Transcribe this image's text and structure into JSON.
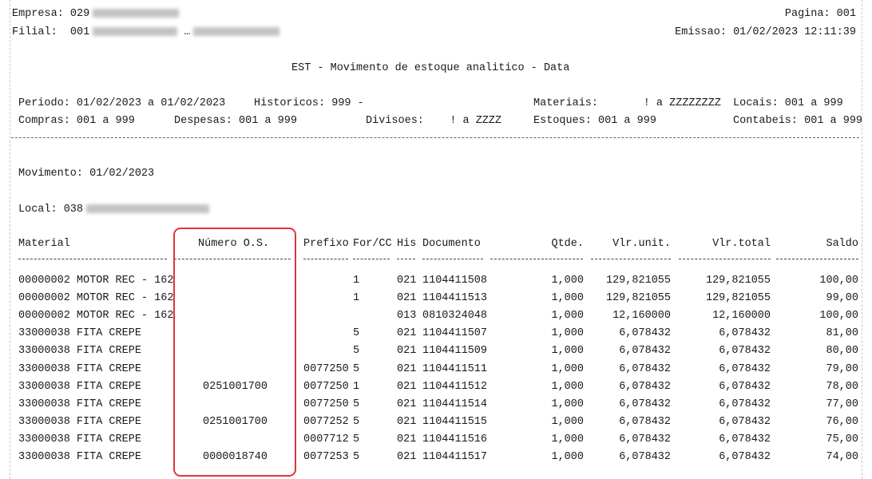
{
  "header": {
    "empresa_label": "Empresa: 029",
    "filial_label": "Filial:",
    "filial_code": "001",
    "filial_sep": "…",
    "pagina": "Pagina: 001",
    "emissao": "Emissao: 01/02/2023 12:11:39",
    "title": "EST - Movimento de estoque analitico - Data"
  },
  "filters": {
    "periodo": "Periodo: 01/02/2023 a 01/02/2023",
    "historicos": "Historicos: 999 -",
    "materiais": "Materiais:       ! a ZZZZZZZZ",
    "locais": "Locais: 001 a 999",
    "compras": "Compras: 001 a 999",
    "despesas": "Despesas: 001 a 999",
    "divisoes": "Divisoes:    ! a ZZZZ",
    "estoques": "Estoques: 001 a 999",
    "contabeis": "Contabeis: 001 a 999"
  },
  "movimento": "Movimento: 01/02/2023",
  "local_label": "Local: 038",
  "columns": {
    "material": "Material",
    "numero_os": "Número O.S.",
    "prefixo": "Prefixo",
    "forcc": "For/CC",
    "his": "His",
    "documento": "Documento",
    "qtde": "Qtde.",
    "vlrunit": "Vlr.unit.",
    "vlrtotal": "Vlr.total",
    "saldo": "Saldo"
  },
  "rows": [
    {
      "material": "00000002 MOTOR REC - 162",
      "os": "",
      "prefixo": "",
      "forcc": "1",
      "his": "021",
      "doc": "1104411508",
      "qtde": "1,000",
      "vunit": "129,821055",
      "vtotal": "129,821055",
      "saldo": "100,00"
    },
    {
      "material": "00000002 MOTOR REC - 162",
      "os": "",
      "prefixo": "",
      "forcc": "1",
      "his": "021",
      "doc": "1104411513",
      "qtde": "1,000",
      "vunit": "129,821055",
      "vtotal": "129,821055",
      "saldo": "99,00"
    },
    {
      "material": "00000002 MOTOR REC - 162",
      "os": "",
      "prefixo": "",
      "forcc": "",
      "his": "013",
      "doc": "0810324048",
      "qtde": "1,000",
      "vunit": "12,160000",
      "vtotal": "12,160000",
      "saldo": "100,00"
    },
    {
      "material": "33000038 FITA CREPE",
      "os": "",
      "prefixo": "",
      "forcc": "5",
      "his": "021",
      "doc": "1104411507",
      "qtde": "1,000",
      "vunit": "6,078432",
      "vtotal": "6,078432",
      "saldo": "81,00"
    },
    {
      "material": "33000038 FITA CREPE",
      "os": "",
      "prefixo": "",
      "forcc": "5",
      "his": "021",
      "doc": "1104411509",
      "qtde": "1,000",
      "vunit": "6,078432",
      "vtotal": "6,078432",
      "saldo": "80,00"
    },
    {
      "material": "33000038 FITA CREPE",
      "os": "",
      "prefixo": "0077250",
      "forcc": "5",
      "his": "021",
      "doc": "1104411511",
      "qtde": "1,000",
      "vunit": "6,078432",
      "vtotal": "6,078432",
      "saldo": "79,00"
    },
    {
      "material": "33000038 FITA CREPE",
      "os": "0251001700",
      "prefixo": "0077250",
      "forcc": "1",
      "his": "021",
      "doc": "1104411512",
      "qtde": "1,000",
      "vunit": "6,078432",
      "vtotal": "6,078432",
      "saldo": "78,00"
    },
    {
      "material": "33000038 FITA CREPE",
      "os": "",
      "prefixo": "0077250",
      "forcc": "5",
      "his": "021",
      "doc": "1104411514",
      "qtde": "1,000",
      "vunit": "6,078432",
      "vtotal": "6,078432",
      "saldo": "77,00"
    },
    {
      "material": "33000038 FITA CREPE",
      "os": "0251001700",
      "prefixo": "0077252",
      "forcc": "5",
      "his": "021",
      "doc": "1104411515",
      "qtde": "1,000",
      "vunit": "6,078432",
      "vtotal": "6,078432",
      "saldo": "76,00"
    },
    {
      "material": "33000038 FITA CREPE",
      "os": "",
      "prefixo": "0007712",
      "forcc": "5",
      "his": "021",
      "doc": "1104411516",
      "qtde": "1,000",
      "vunit": "6,078432",
      "vtotal": "6,078432",
      "saldo": "75,00"
    },
    {
      "material": "33000038 FITA CREPE",
      "os": "0000018740",
      "prefixo": "0077253",
      "forcc": "5",
      "his": "021",
      "doc": "1104411517",
      "qtde": "1,000",
      "vunit": "6,078432",
      "vtotal": "6,078432",
      "saldo": "74,00"
    }
  ],
  "colors": {
    "highlight": "#e0343c",
    "text": "#1a1a1a"
  }
}
